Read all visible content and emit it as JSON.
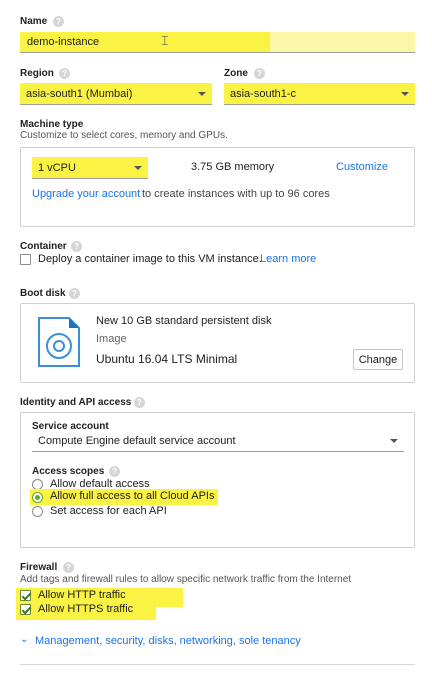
{
  "name": {
    "label": "Name",
    "value": "demo-instance"
  },
  "region": {
    "label": "Region",
    "value": "asia-south1 (Mumbai)"
  },
  "zone": {
    "label": "Zone",
    "value": "asia-south1-c"
  },
  "machine_type": {
    "label": "Machine type",
    "description": "Customize to select cores, memory and GPUs.",
    "cpu_value": "1 vCPU",
    "memory": "3.75 GB memory",
    "customize_link": "Customize",
    "upgrade_link": "Upgrade your account",
    "upgrade_text": "to create instances with up to 96 cores"
  },
  "container": {
    "label": "Container",
    "checkbox_text": "Deploy a container image to this VM instance.",
    "learn_more": "Learn more"
  },
  "boot_disk": {
    "label": "Boot disk",
    "title": "New 10 GB standard persistent disk",
    "subtitle": "Image",
    "image_name": "Ubuntu 16.04 LTS Minimal",
    "change_button": "Change"
  },
  "identity": {
    "label": "Identity and API access",
    "service_account_label": "Service account",
    "service_account_value": "Compute Engine default service account",
    "access_scopes_label": "Access scopes",
    "options": [
      {
        "label": "Allow default access",
        "selected": false
      },
      {
        "label": "Allow full access to all Cloud APIs",
        "selected": true
      },
      {
        "label": "Set access for each API",
        "selected": false
      }
    ]
  },
  "firewall": {
    "label": "Firewall",
    "description": "Add tags and firewall rules to allow specific network traffic from the Internet",
    "http_label": "Allow HTTP traffic",
    "https_label": "Allow HTTPS traffic"
  },
  "management_link": "Management, security, disks, networking, sole tenancy",
  "help_glyph": "?",
  "colors": {
    "accent": "#1a73e8",
    "highlight": "#fbf344",
    "green": "#5cae2c"
  }
}
